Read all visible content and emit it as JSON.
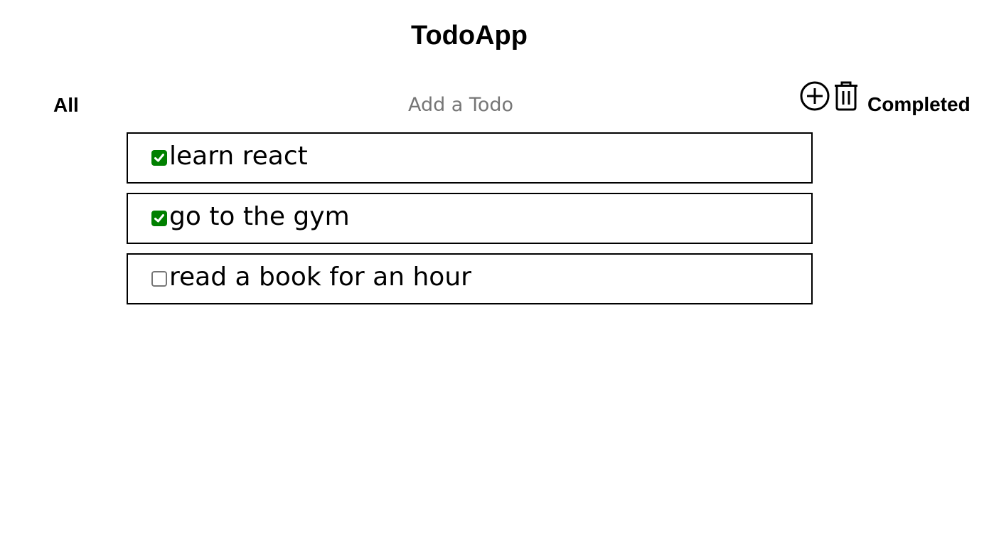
{
  "app": {
    "title": "TodoApp"
  },
  "filters": {
    "all_label": "All",
    "completed_label": "Completed"
  },
  "add_todo": {
    "placeholder": "Add a Todo",
    "value": ""
  },
  "icons": {
    "add": "plus-circle-icon",
    "delete": "trash-icon"
  },
  "colors": {
    "checked": "#008000",
    "border": "#000000",
    "placeholder": "#767676"
  },
  "todos": [
    {
      "text": "learn react",
      "completed": true
    },
    {
      "text": "go to the gym",
      "completed": true
    },
    {
      "text": "read a book for an hour",
      "completed": false
    }
  ]
}
